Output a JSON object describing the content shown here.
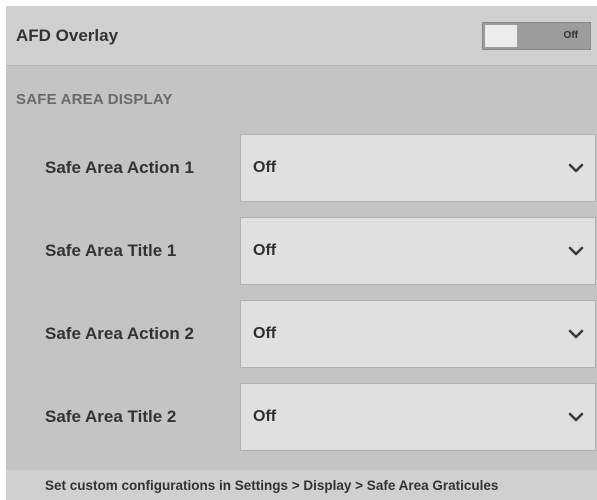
{
  "afd_overlay": {
    "label": "AFD Overlay",
    "toggle_state": "Off"
  },
  "safe_area_display": {
    "section_title": "SAFE AREA DISPLAY",
    "settings": [
      {
        "label": "Safe Area Action 1",
        "value": "Off"
      },
      {
        "label": "Safe Area Title 1",
        "value": "Off"
      },
      {
        "label": "Safe Area Action 2",
        "value": "Off"
      },
      {
        "label": "Safe Area Title 2",
        "value": "Off"
      }
    ]
  },
  "footer": {
    "note": "Set custom configurations in Settings > Display > Safe Area Graticules"
  }
}
